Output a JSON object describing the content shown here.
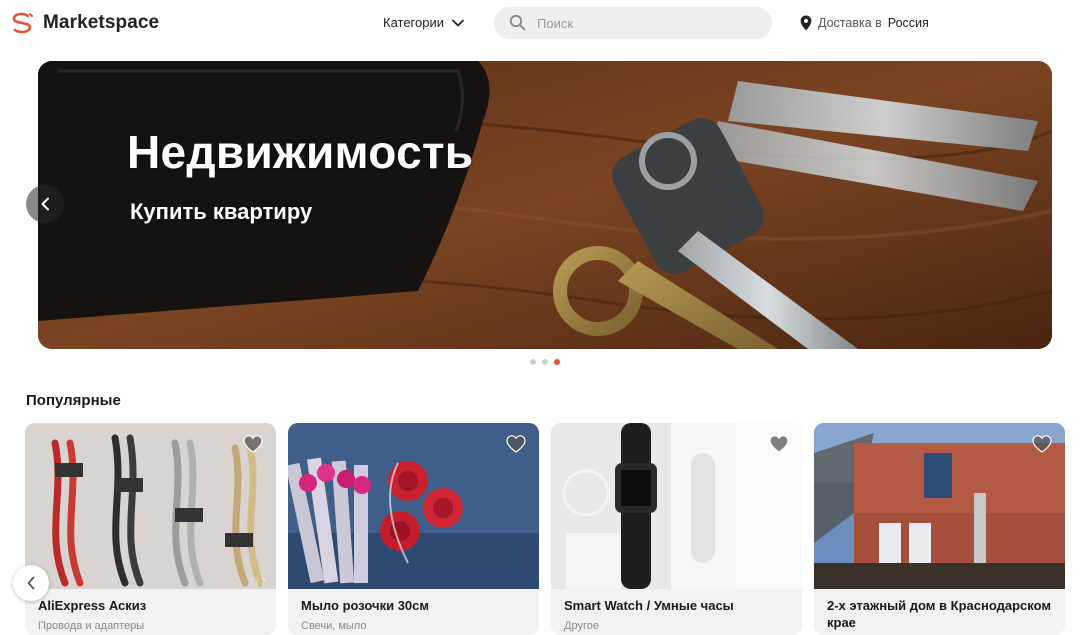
{
  "header": {
    "brand": "Marketspace",
    "categories_label": "Категории",
    "search_placeholder": "Поиск",
    "delivery_prefix": "Доставка в",
    "delivery_country": "Россия"
  },
  "banner": {
    "title": "Недвижимость",
    "subtitle": "Купить квартиру",
    "slide_count": 3,
    "active_slide": 3
  },
  "popular": {
    "title": "Популярные",
    "cards": [
      {
        "title": "AliExpress Аскиз",
        "category": "Провода и адаптеры",
        "counter": "7 / 7"
      },
      {
        "title": "Мыло розочки 30см",
        "category": "Свечи, мыло",
        "counter": ""
      },
      {
        "title": "Smart Watch / Умные часы",
        "category": "Другое",
        "counter": ""
      },
      {
        "title": "2-х этажный дом в Краснодарском крае",
        "category": "",
        "counter": ""
      }
    ]
  },
  "colors": {
    "accent": "#e8503a",
    "card_bg": "#f2f2f2",
    "search_bg": "#efefef"
  },
  "icons": {
    "logo": "marketspace-logo-icon",
    "search": "search-icon",
    "chevron": "chevron-down-icon",
    "location": "location-pin-icon",
    "favorite": "heart-icon",
    "prev": "chevron-left-icon"
  }
}
